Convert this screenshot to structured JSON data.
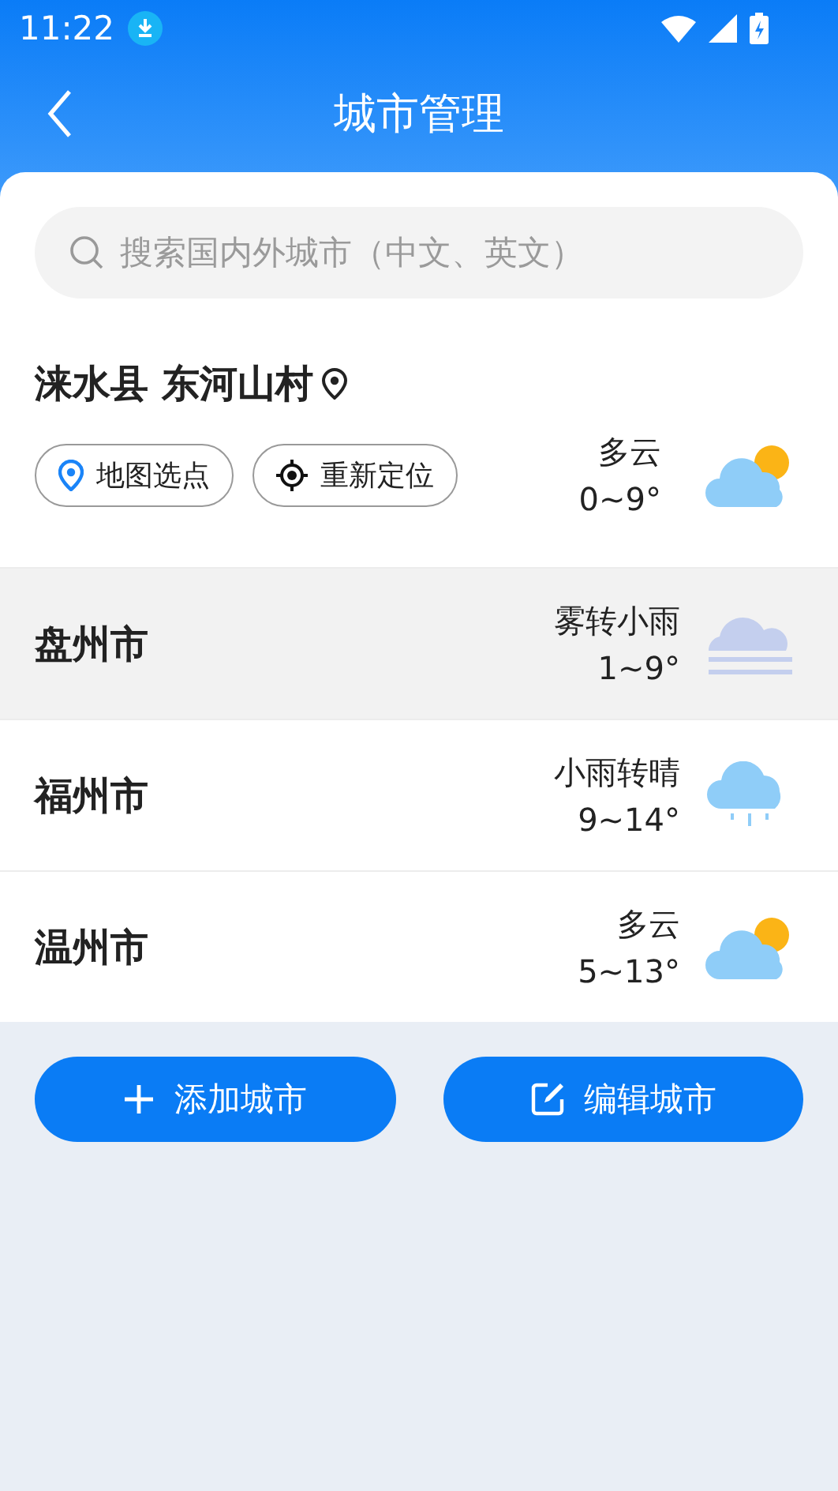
{
  "status_bar": {
    "time": "11:22"
  },
  "header": {
    "title": "城市管理"
  },
  "search": {
    "placeholder": "搜索国内外城市（中文、英文）"
  },
  "current_location": {
    "name": "涞水县 东河山村",
    "buttons": [
      {
        "label": "地图选点",
        "kind": "pin"
      },
      {
        "label": "重新定位",
        "kind": "locate"
      }
    ],
    "weather": {
      "condition": "多云",
      "range": "0~9°",
      "kind": "cloudy"
    }
  },
  "cities": [
    {
      "name": "盘州市",
      "selected": true,
      "weather": {
        "condition": "雾转小雨",
        "range": "1~9°",
        "kind": "fog"
      }
    },
    {
      "name": "福州市",
      "selected": false,
      "weather": {
        "condition": "小雨转晴",
        "range": "9~14°",
        "kind": "rain"
      }
    },
    {
      "name": "温州市",
      "selected": false,
      "weather": {
        "condition": "多云",
        "range": "5~13°",
        "kind": "cloudy"
      }
    }
  ],
  "actions": [
    {
      "label": "添加城市",
      "kind": "add"
    },
    {
      "label": "编辑城市",
      "kind": "edit"
    }
  ]
}
